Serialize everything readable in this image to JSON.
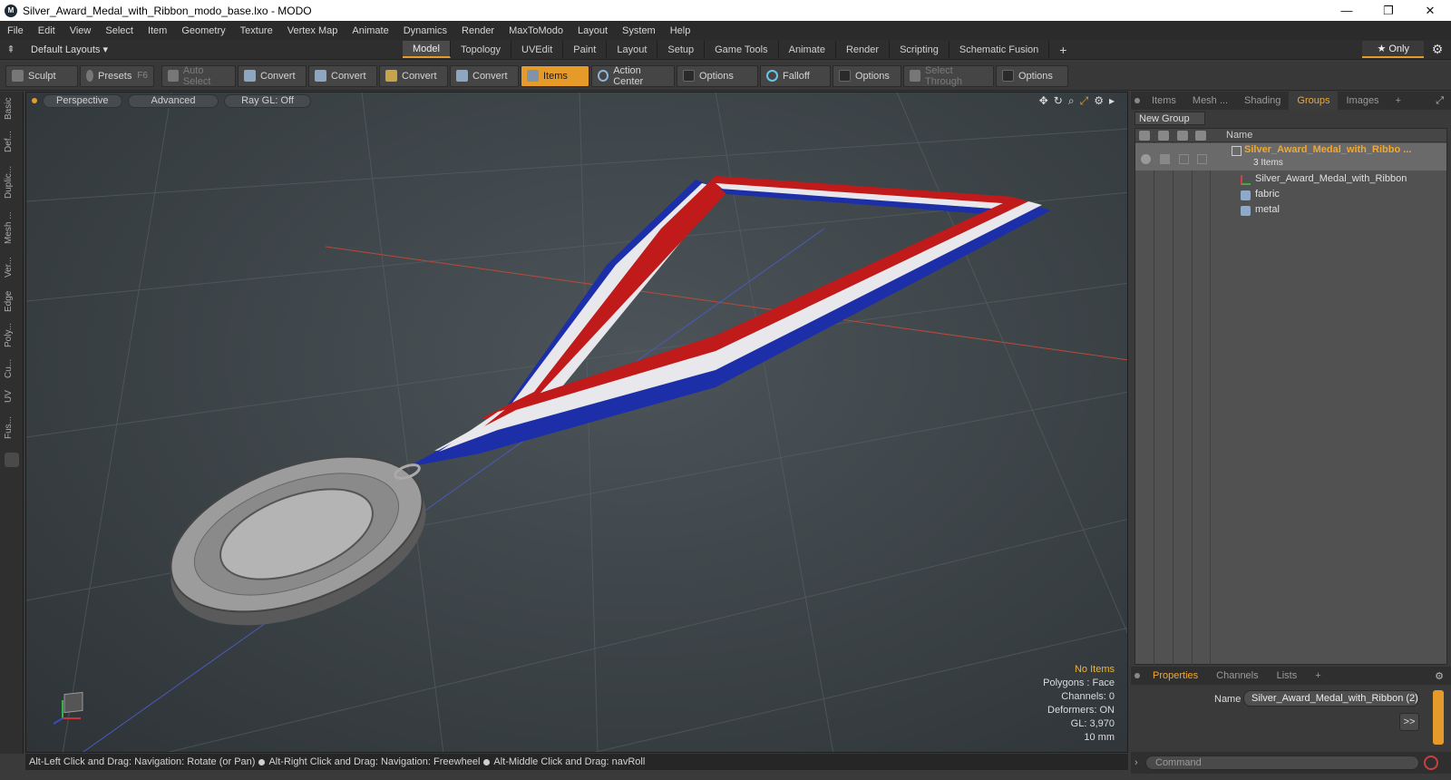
{
  "window": {
    "title": "Silver_Award_Medal_with_Ribbon_modo_base.lxo - MODO",
    "minimize": "—",
    "maximize": "❐",
    "close": "✕"
  },
  "menu": [
    "File",
    "Edit",
    "View",
    "Select",
    "Item",
    "Geometry",
    "Texture",
    "Vertex Map",
    "Animate",
    "Dynamics",
    "Render",
    "MaxToModo",
    "Layout",
    "System",
    "Help"
  ],
  "layouts": {
    "label": "Default Layouts ▾"
  },
  "tabs": [
    "Model",
    "Topology",
    "UVEdit",
    "Paint",
    "Layout",
    "Setup",
    "Game Tools",
    "Animate",
    "Render",
    "Scripting",
    "Schematic Fusion",
    "+"
  ],
  "only": "★ Only",
  "toolbar": {
    "sculpt": "Sculpt",
    "presets": "Presets",
    "presets_key": "F6",
    "auto_select": "Auto Select",
    "convert1": "Convert",
    "convert2": "Convert",
    "convert3": "Convert",
    "convert4": "Convert",
    "items": "Items",
    "action_center": "Action Center",
    "options1": "Options",
    "falloff": "Falloff",
    "options2": "Options",
    "select_through": "Select Through",
    "options3": "Options"
  },
  "left_tabs": [
    "Basic",
    "Def...",
    "Duplic...",
    "Mesh ...",
    "Ver...",
    "Edge",
    "Poly...",
    "Cu...",
    "UV",
    "Fus..."
  ],
  "viewport": {
    "perspective": "Perspective",
    "advanced": "Advanced",
    "raygl": "Ray GL: Off",
    "info": {
      "no_items": "No Items",
      "polygons": "Polygons : Face",
      "channels": "Channels: 0",
      "deformers": "Deformers: ON",
      "gl": "GL: 3,970",
      "scale": "10 mm"
    }
  },
  "status": {
    "part1": "Alt-Left Click and Drag: Navigation: Rotate (or Pan)",
    "part2": "Alt-Right Click and Drag: Navigation: Freewheel",
    "part3": "Alt-Middle Click and Drag: navRoll"
  },
  "right_tabs": [
    "Items",
    "Mesh ...",
    "Shading",
    "Groups",
    "Images",
    "+"
  ],
  "groups": {
    "new_group": "New Group",
    "name_header": "Name",
    "root": "Silver_Award_Medal_with_Ribbo ...",
    "count": "3 Items",
    "children": [
      "Silver_Award_Medal_with_Ribbon",
      "fabric",
      "metal"
    ]
  },
  "props": {
    "tabs": [
      "Properties",
      "Channels",
      "Lists",
      "+"
    ],
    "name_label": "Name",
    "name_value": "Silver_Award_Medal_with_Ribbon (2)",
    "more": ">>"
  },
  "command": {
    "placeholder": "Command"
  }
}
